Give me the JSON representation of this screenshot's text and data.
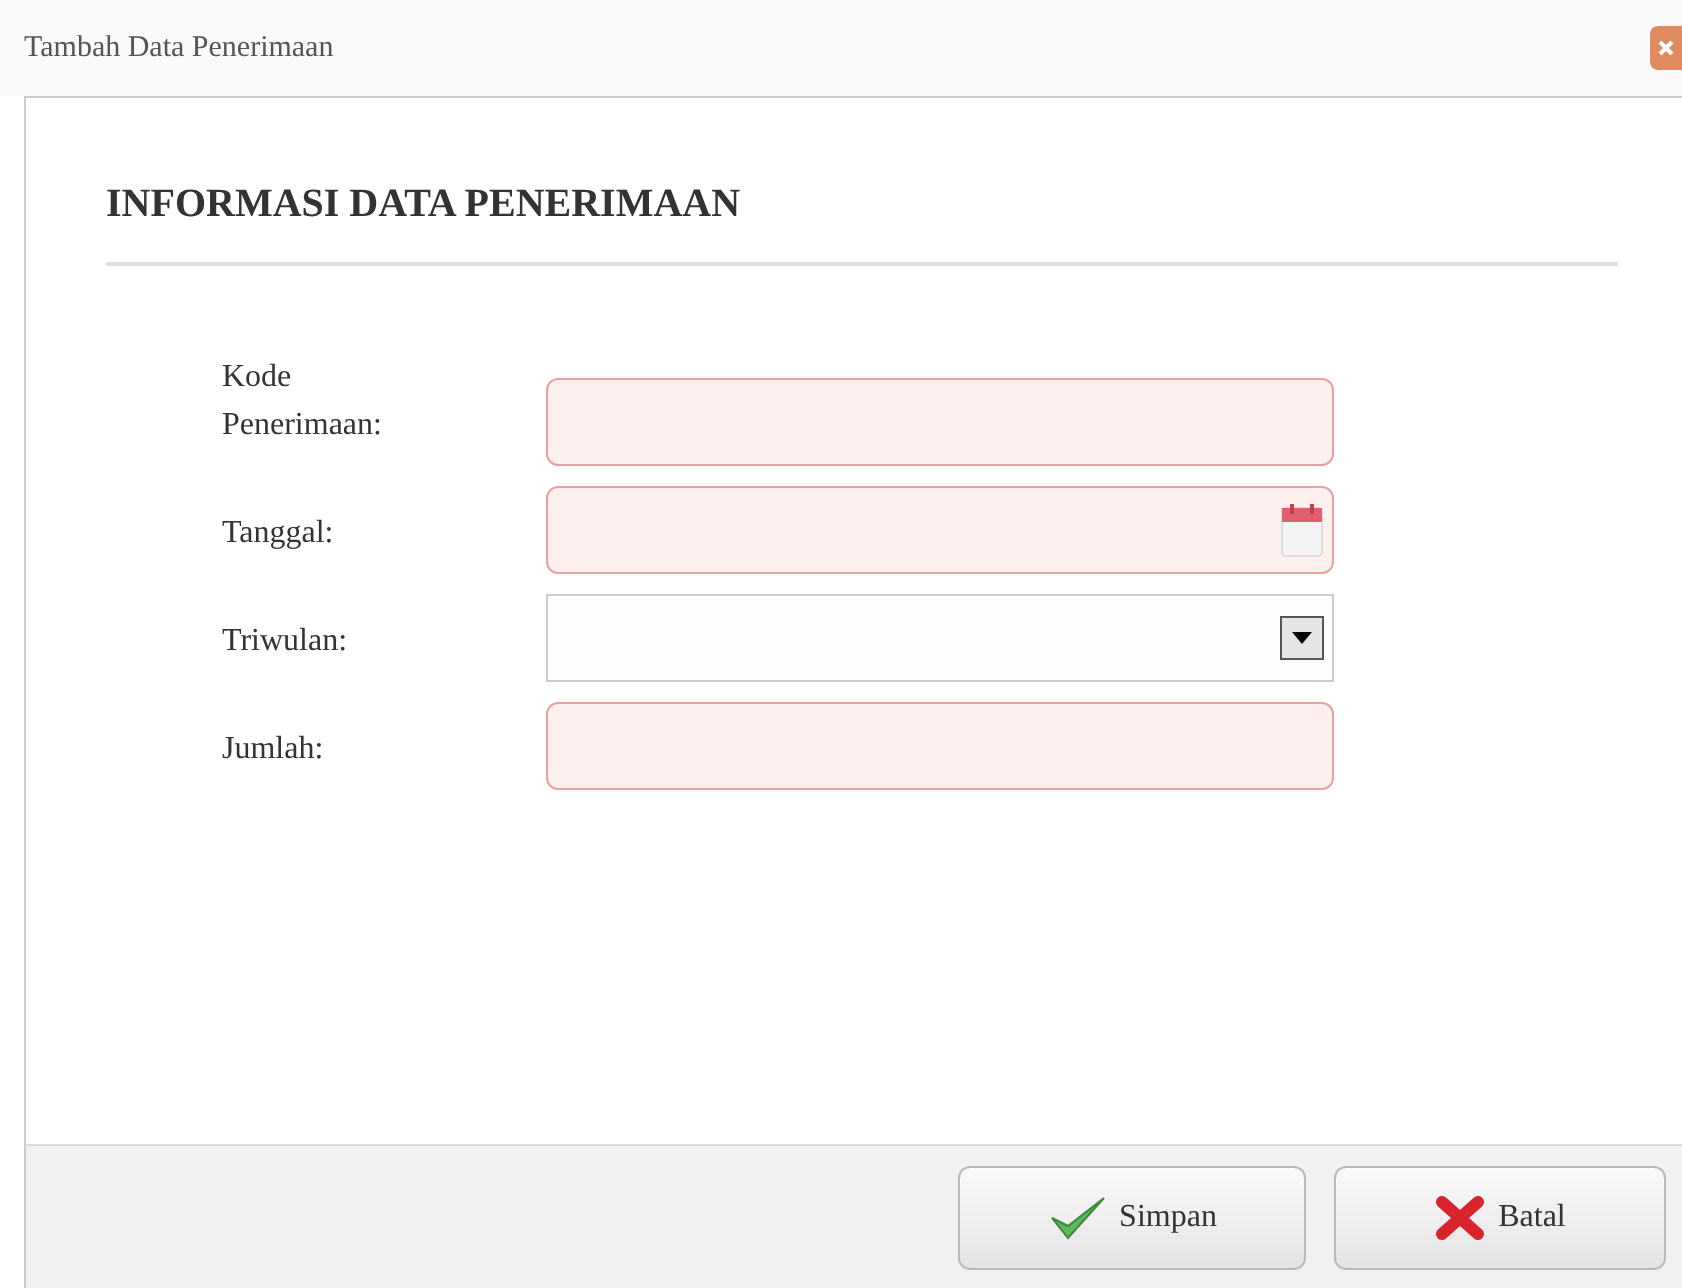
{
  "window": {
    "title": "Tambah Data Penerimaan"
  },
  "section": {
    "heading": "INFORMASI DATA PENERIMAAN"
  },
  "fields": [
    {
      "label": "Kode Penerimaan:",
      "kind": "text",
      "invalid": true
    },
    {
      "label": "Tanggal:",
      "kind": "date",
      "invalid": true
    },
    {
      "label": "Triwulan:",
      "kind": "select",
      "invalid": false
    },
    {
      "label": "Jumlah:",
      "kind": "text",
      "invalid": true
    }
  ],
  "buttons": [
    {
      "label": "Simpan",
      "kind": "save"
    },
    {
      "label": "Batal",
      "kind": "cancel"
    }
  ]
}
